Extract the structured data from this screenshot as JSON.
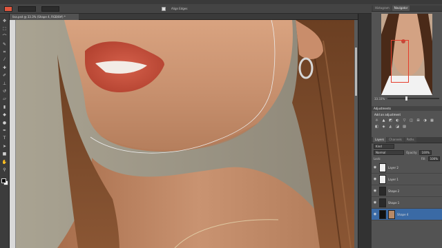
{
  "document": {
    "tab_title": "lisa.psd @ 33.3% (Shape 4, RGB/8#) *"
  },
  "options_bar": {
    "fill_color": "#e0563e",
    "field1": "",
    "field2": "",
    "align_edges_label": "Align Edges"
  },
  "tools": [
    {
      "name": "move-tool",
      "glyph": "✥"
    },
    {
      "name": "marquee-tool",
      "glyph": "⬚"
    },
    {
      "name": "lasso-tool",
      "glyph": "⌒"
    },
    {
      "name": "quick-select-tool",
      "glyph": "✎"
    },
    {
      "name": "crop-tool",
      "glyph": "⌗"
    },
    {
      "name": "eyedropper-tool",
      "glyph": "⁄"
    },
    {
      "name": "healing-tool",
      "glyph": "✚"
    },
    {
      "name": "brush-tool",
      "glyph": "✐"
    },
    {
      "name": "clone-stamp-tool",
      "glyph": "⊥"
    },
    {
      "name": "history-brush-tool",
      "glyph": "↺"
    },
    {
      "name": "eraser-tool",
      "glyph": "▱"
    },
    {
      "name": "gradient-tool",
      "glyph": "▮"
    },
    {
      "name": "blur-tool",
      "glyph": "◆"
    },
    {
      "name": "dodge-tool",
      "glyph": "●"
    },
    {
      "name": "pen-tool",
      "glyph": "✒"
    },
    {
      "name": "type-tool",
      "glyph": "T"
    },
    {
      "name": "path-select-tool",
      "glyph": "➤"
    },
    {
      "name": "shape-tool",
      "glyph": "■"
    },
    {
      "name": "hand-tool",
      "glyph": "✋"
    },
    {
      "name": "zoom-tool",
      "glyph": "⚲"
    }
  ],
  "panels": {
    "top_tabs": [
      "Histogram",
      "Navigator"
    ],
    "zoom": "33.33%",
    "adjustments_tab": "Adjustments",
    "adjustments_title": "Add an adjustment",
    "adj_icons": [
      "☼",
      "▲",
      "◩",
      "◐",
      "▽",
      "◫",
      "⊞",
      "◑",
      "▦",
      "◧",
      "◈",
      "◭",
      "◪",
      "▨"
    ],
    "layers_tabs": [
      "Layers",
      "Channels",
      "Paths"
    ],
    "kind_label": "Kind",
    "blend_mode": "Normal",
    "opacity_label": "Opacity:",
    "opacity_value": "100%",
    "lock_label": "Lock:",
    "fill_label": "Fill:",
    "fill_value": "100%",
    "layers": [
      {
        "name": "Layer 2",
        "thumb": "white",
        "selected": false
      },
      {
        "name": "Layer 1",
        "thumb": "white",
        "selected": false
      },
      {
        "name": "Shape 2",
        "thumb": "shape",
        "selected": false
      },
      {
        "name": "Shape 1",
        "thumb": "shape",
        "selected": false
      },
      {
        "name": "Shape 4",
        "thumb": "mask",
        "selected": true
      }
    ]
  }
}
